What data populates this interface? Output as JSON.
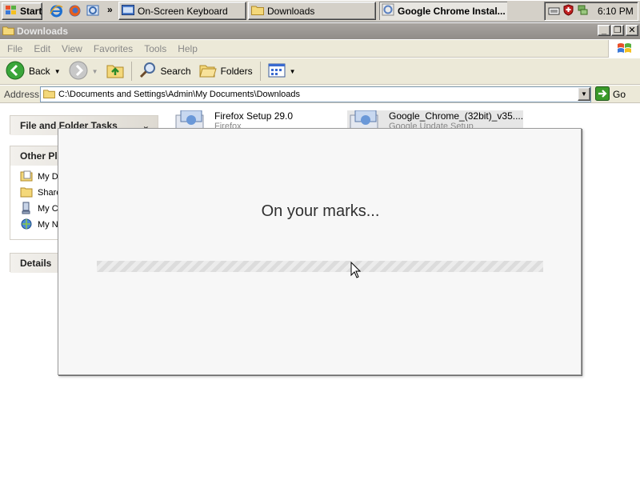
{
  "taskbar": {
    "start_label": "Start",
    "tasks": [
      {
        "label": "On-Screen Keyboard"
      },
      {
        "label": "Downloads"
      },
      {
        "label": "Google Chrome Instal..."
      }
    ],
    "quicklaunch_icons": [
      "ie-icon",
      "firefox-icon",
      "outlook-express-icon"
    ],
    "clock": "6:10 PM"
  },
  "window": {
    "title": "Downloads",
    "menu": [
      "File",
      "Edit",
      "View",
      "Favorites",
      "Tools",
      "Help"
    ],
    "toolbar": {
      "back": "Back",
      "search": "Search",
      "folders": "Folders"
    },
    "address": {
      "label": "Address",
      "path": "C:\\Documents and Settings\\Admin\\My Documents\\Downloads",
      "go": "Go"
    }
  },
  "sidebar": {
    "file_tasks": "File and Folder Tasks",
    "other_places": "Other Pla",
    "places": [
      "My D",
      "Share",
      "My C",
      "My N"
    ],
    "details": "Details"
  },
  "files": [
    {
      "name": "Firefox Setup 29.0",
      "sub": "Firefox"
    },
    {
      "name": "Google_Chrome_(32bit)_v35....",
      "sub": "Google Update Setup"
    }
  ],
  "dialog": {
    "message": "On your marks...",
    "progress": 0.0
  },
  "colors": {
    "desktop_gray": "#d4d0c8",
    "titlebar_inactive": "#a8a4a0",
    "dialog_bg": "#f7f7f7",
    "go_green": "#3a9a2a"
  }
}
